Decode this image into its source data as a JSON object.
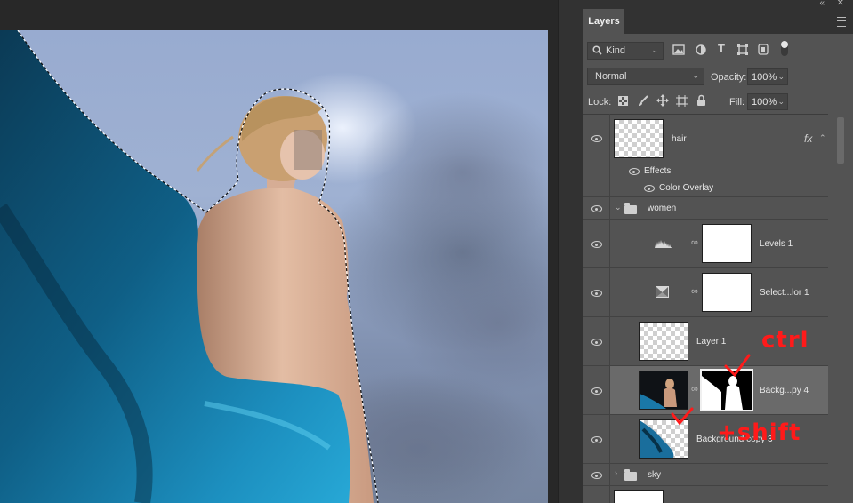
{
  "panel": {
    "tab_label": "Layers",
    "filter_kind": "Kind",
    "blend_mode": "Normal",
    "opacity_label": "Opacity:",
    "opacity_value": "100%",
    "lock_label": "Lock:",
    "fill_label": "Fill:",
    "fill_value": "100%"
  },
  "layers": {
    "hair": {
      "name": "hair",
      "fx": "fx"
    },
    "effects": {
      "label": "Effects"
    },
    "color_overlay": {
      "label": "Color Overlay"
    },
    "women": {
      "name": "women"
    },
    "levels": {
      "name": "Levels 1"
    },
    "selective": {
      "name": "Select...lor 1"
    },
    "layer1": {
      "name": "Layer 1"
    },
    "bg_copy4": {
      "name": "Backg...py 4"
    },
    "bg_copy3": {
      "name": "Background copy 3"
    },
    "sky": {
      "name": "sky"
    }
  },
  "annotations": {
    "ctrl": "ctrl",
    "shift": "+shift"
  },
  "icons": [
    "search-icon",
    "image-filter-icon",
    "adjustment-filter-icon",
    "type-filter-icon",
    "shape-filter-icon",
    "smart-object-filter-icon",
    "lock-transparent-icon",
    "lock-brush-icon",
    "lock-move-icon",
    "lock-artboard-icon",
    "lock-all-icon",
    "eye-icon",
    "link-icon",
    "folder-icon",
    "levels-icon",
    "selective-color-icon",
    "panel-menu-icon"
  ]
}
